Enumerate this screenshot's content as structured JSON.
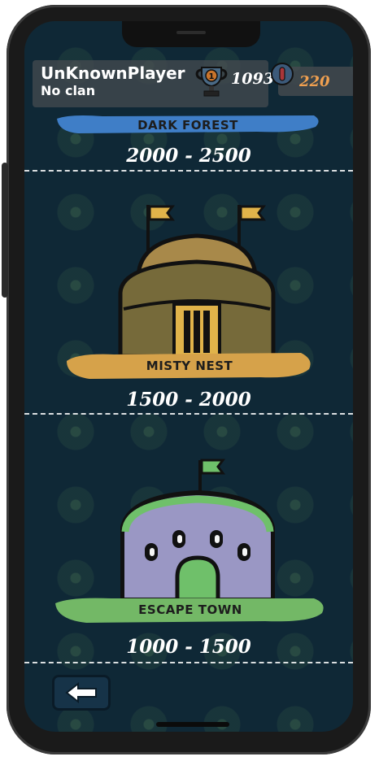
{
  "player": {
    "name": "UnKnownPlayer",
    "clan": "No clan",
    "trophies": "1093",
    "trophy_rank": "1",
    "coins": "220"
  },
  "arenas": [
    {
      "name": "DARK FOREST",
      "range": "2000 - 2500",
      "banner_color": "#3f7ec7"
    },
    {
      "name": "MISTY NEST",
      "range": "1500 - 2000",
      "banner_color": "#d6a24a"
    },
    {
      "name": "ESCAPE TOWN",
      "range": "1000 - 1500",
      "banner_color": "#73b866"
    }
  ],
  "icons": {
    "trophy": "trophy-icon",
    "coin": "coin-icon",
    "back": "back-arrow-icon"
  },
  "colors": {
    "background": "#0f2836",
    "coins_text": "#f0a050"
  }
}
